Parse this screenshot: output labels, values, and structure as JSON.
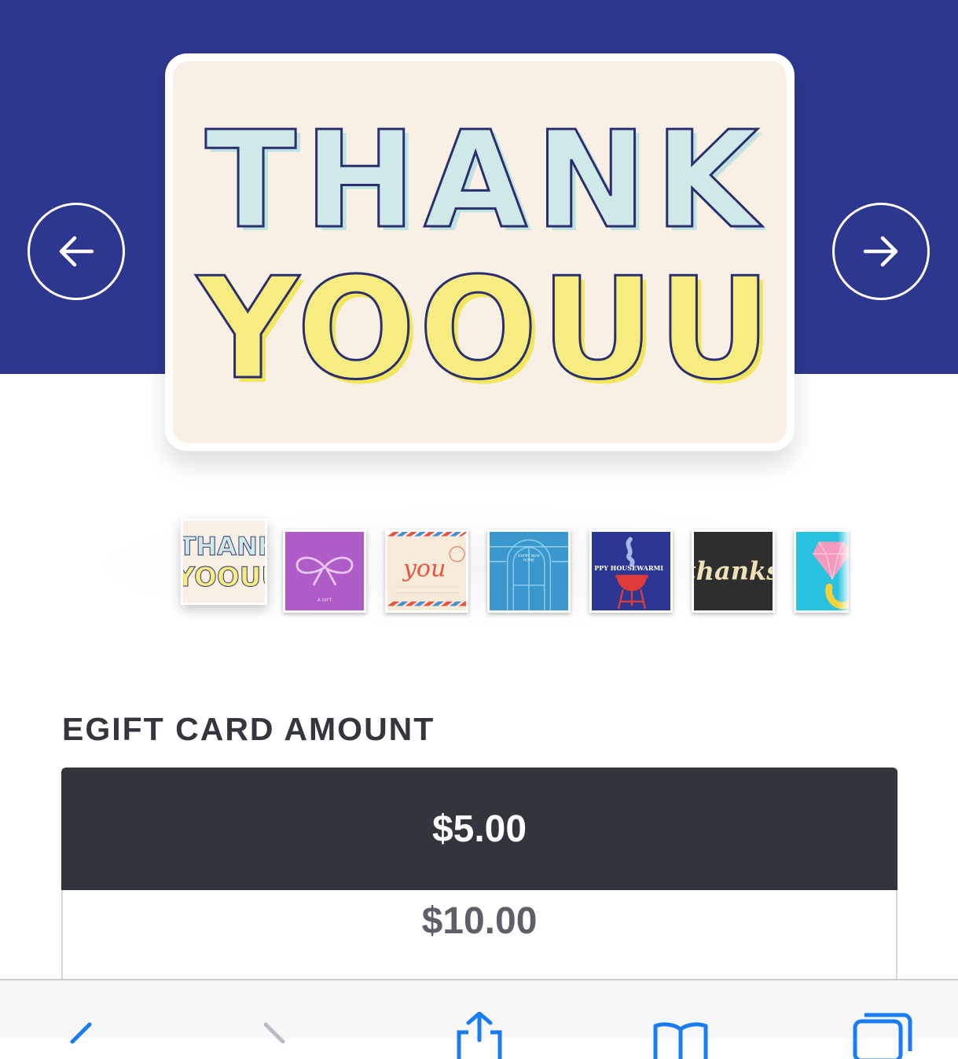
{
  "hero": {
    "band_color": "#2e3790",
    "prev_icon": "arrow-left-icon",
    "next_icon": "arrow-right-icon",
    "card": {
      "line1": "THANK",
      "line2": "YOOUU",
      "background": "#f8f0e5",
      "line1_fill": "#cfe9e8",
      "line2_fill": "#f6ec80",
      "outline": "#2b2f6e"
    }
  },
  "thumbnails": [
    {
      "name": "thank-yoouu",
      "line1": "THANK",
      "line2": "YOOUU",
      "selected": true
    },
    {
      "name": "bow-gift",
      "caption": "A GIFT",
      "color": "#b05cc8"
    },
    {
      "name": "airmail-you",
      "text": "you"
    },
    {
      "name": "happy-new-home",
      "text": "HAPPY NEW HOME",
      "color": "#3a98cc"
    },
    {
      "name": "happy-housewarming",
      "text": "PPY HOUSEWARMI",
      "color": "#2b3792"
    },
    {
      "name": "thanks-script",
      "text": "thanks",
      "color": "#2e2e2e"
    },
    {
      "name": "diamond-ring",
      "color": "#29c2df"
    }
  ],
  "amount_section": {
    "title": "EGIFT CARD AMOUNT",
    "options": [
      {
        "label": "$5.00",
        "selected": true
      },
      {
        "label": "$10.00",
        "selected": false
      }
    ]
  },
  "toolbar": {
    "icons": [
      "back-icon",
      "forward-icon",
      "share-icon",
      "bookmarks-icon",
      "tabs-icon"
    ],
    "accent": "#1a7cf2"
  }
}
